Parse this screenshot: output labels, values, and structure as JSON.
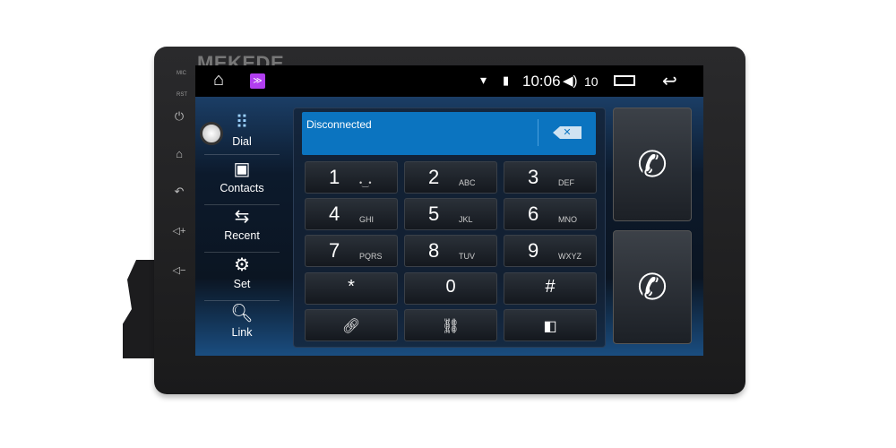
{
  "brand": "MEKEDE",
  "bezel": {
    "mic": "MIC",
    "rst": "RST"
  },
  "status": {
    "time": "10:06",
    "volume": "10",
    "icons": [
      "home-icon",
      "app-icon",
      "wifi-icon",
      "sim-icon",
      "volume-icon",
      "recent-apps-icon",
      "back-icon"
    ]
  },
  "sidebar": {
    "items": [
      {
        "label": "Dial",
        "icon": "dialpad-icon"
      },
      {
        "label": "Contacts",
        "icon": "contacts-icon"
      },
      {
        "label": "Recent",
        "icon": "recent-calls-icon"
      },
      {
        "label": "Set",
        "icon": "gear-icon"
      },
      {
        "label": "Link",
        "icon": "search-icon"
      }
    ]
  },
  "display": {
    "status": "Disconnected"
  },
  "keys": [
    {
      "digit": "1",
      "letters": "•‿•"
    },
    {
      "digit": "2",
      "letters": "ABC"
    },
    {
      "digit": "3",
      "letters": "DEF"
    },
    {
      "digit": "4",
      "letters": "GHI"
    },
    {
      "digit": "5",
      "letters": "JKL"
    },
    {
      "digit": "6",
      "letters": "MNO"
    },
    {
      "digit": "7",
      "letters": "PQRS"
    },
    {
      "digit": "8",
      "letters": "TUV"
    },
    {
      "digit": "9",
      "letters": "WXYZ"
    },
    {
      "digit": "*"
    },
    {
      "digit": "0"
    },
    {
      "digit": "#"
    }
  ],
  "bottom_keys": [
    "link-icon",
    "unlink-icon",
    "voice-transfer-icon"
  ],
  "call_buttons": [
    "call-icon",
    "hangup-icon"
  ]
}
